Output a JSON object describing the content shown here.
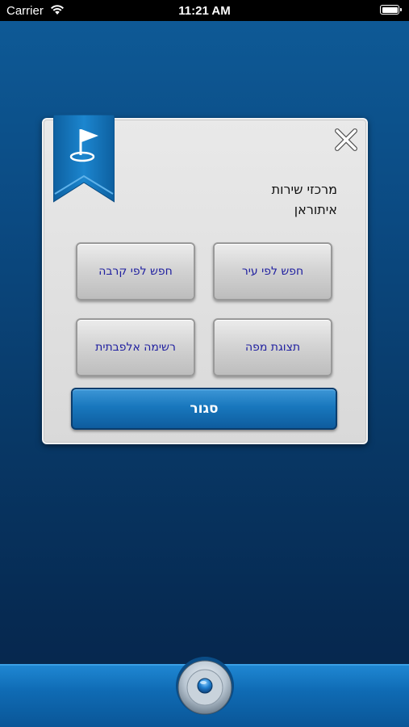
{
  "status_bar": {
    "carrier": "Carrier",
    "time": "11:21 AM"
  },
  "dialog": {
    "title_line1": "מרכזי שירות",
    "title_line2": "איתוראן",
    "buttons": {
      "search_by_city": "חפש לפי עיר",
      "search_by_proximity": "חפש לפי קרבה",
      "map_view": "תצוגת מפה",
      "alphabetical_list": "רשימה אלפבתית"
    },
    "close_label": "סגור"
  },
  "colors": {
    "background_top": "#0e5b98",
    "background_bottom": "#05244a",
    "button_text": "#2020a0",
    "accent_blue": "#1877bd"
  },
  "icons": {
    "ribbon": "flag-pin-icon",
    "close": "close-icon",
    "home": "home-knob-icon"
  }
}
